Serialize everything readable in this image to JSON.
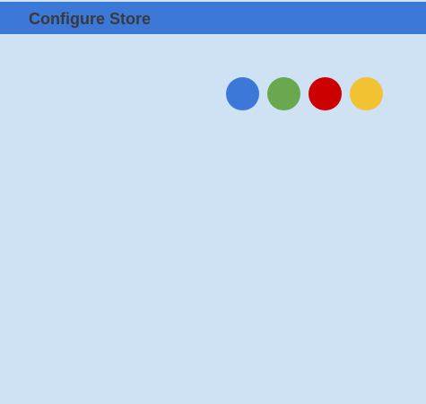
{
  "header": {
    "title": "Configure Store",
    "color": "#3c78d8"
  },
  "background_color": "#cfe2f3",
  "color_options": [
    {
      "name": "blue",
      "color": "#3c78d8"
    },
    {
      "name": "green",
      "color": "#6aa84f"
    },
    {
      "name": "red",
      "color": "#cc0000"
    },
    {
      "name": "yellow",
      "color": "#f1c232"
    }
  ]
}
